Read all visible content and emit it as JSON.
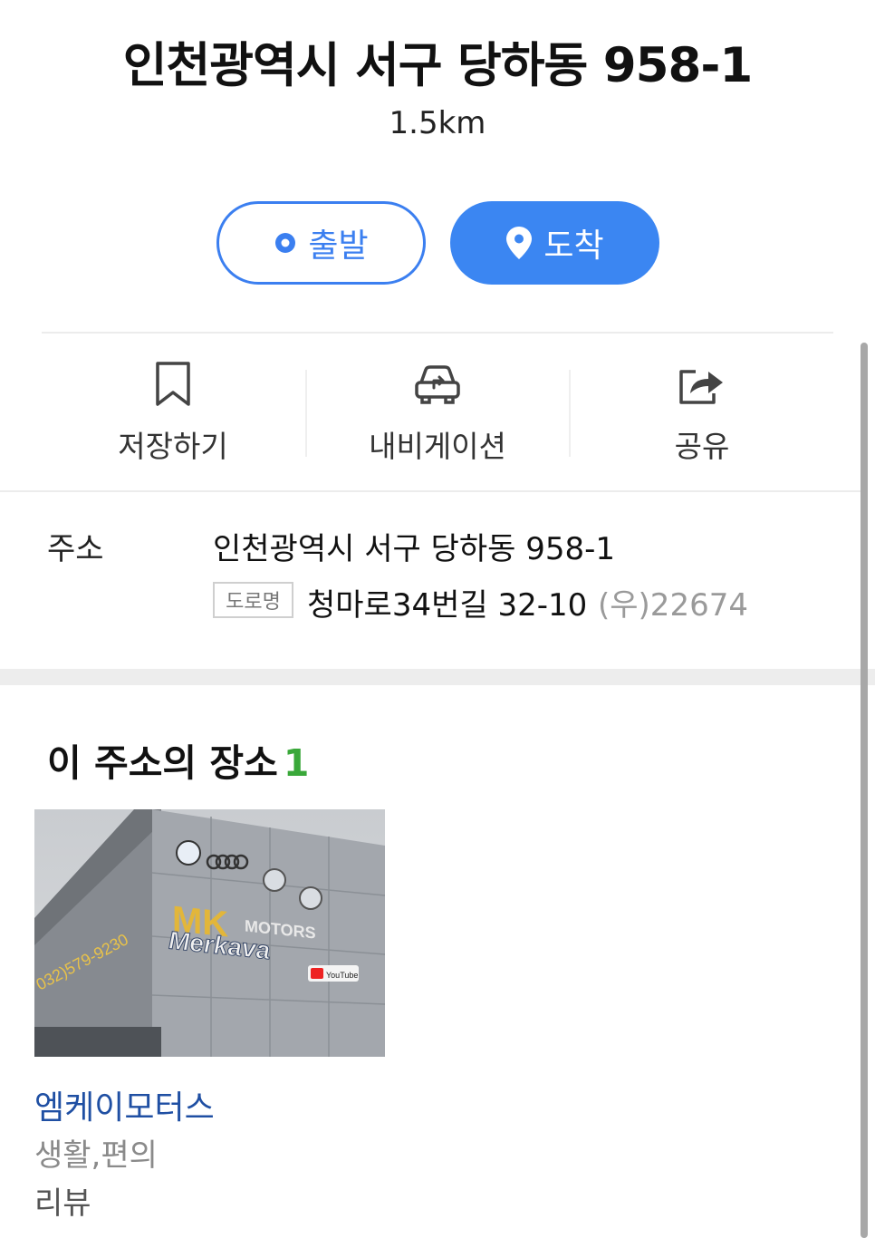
{
  "header": {
    "title": "인천광역시 서구 당하동 958-1",
    "distance": "1.5km"
  },
  "buttons": {
    "start_label": "출발",
    "arrive_label": "도착"
  },
  "actions": [
    {
      "label": "저장하기",
      "icon": "bookmark-icon"
    },
    {
      "label": "내비게이션",
      "icon": "navigation-car-icon"
    },
    {
      "label": "공유",
      "icon": "share-icon"
    }
  ],
  "address": {
    "label": "주소",
    "jibun": "인천광역시 서구 당하동 958-1",
    "road_badge": "도로명",
    "road": "청마로34번길 32-10",
    "postal": "(우)22674"
  },
  "places": {
    "heading": "이 주소의 장소",
    "count": "1",
    "items": [
      {
        "name": "엠케이모터스",
        "category": "생활,편의",
        "review": "리뷰",
        "photo_sign_brand": "MK",
        "photo_sign_sub": "MOTORS",
        "photo_sign_merkava": "Merkava",
        "photo_sign_phone": "032)579-9230",
        "photo_sign_yt": "YouTube"
      }
    ]
  },
  "colors": {
    "accent": "#3b86f2",
    "place_link": "#1f4fa3",
    "count_green": "#3aa83a"
  }
}
